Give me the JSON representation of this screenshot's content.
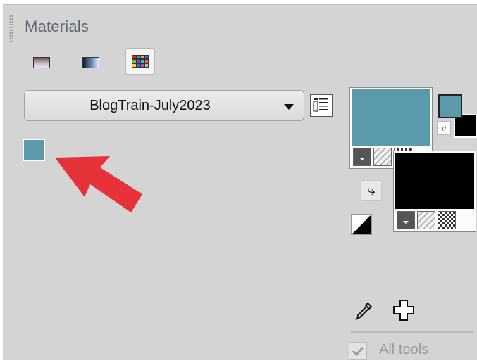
{
  "panel": {
    "title": "Materials"
  },
  "view_buttons": [
    {
      "name": "frame-view-icon"
    },
    {
      "name": "gradient-view-icon"
    },
    {
      "name": "swatch-grid-view-icon"
    }
  ],
  "palette": {
    "selected": "BlogTrain-July2023"
  },
  "swatches": [
    {
      "color": "#5a9aab"
    }
  ],
  "foreground": {
    "color": "#5a9aab"
  },
  "background": {
    "color": "#000000"
  },
  "tools": {
    "all_tools_label": "All tools",
    "all_tools_checked": true
  },
  "annotation": {
    "arrow_color": "#e8323a"
  }
}
